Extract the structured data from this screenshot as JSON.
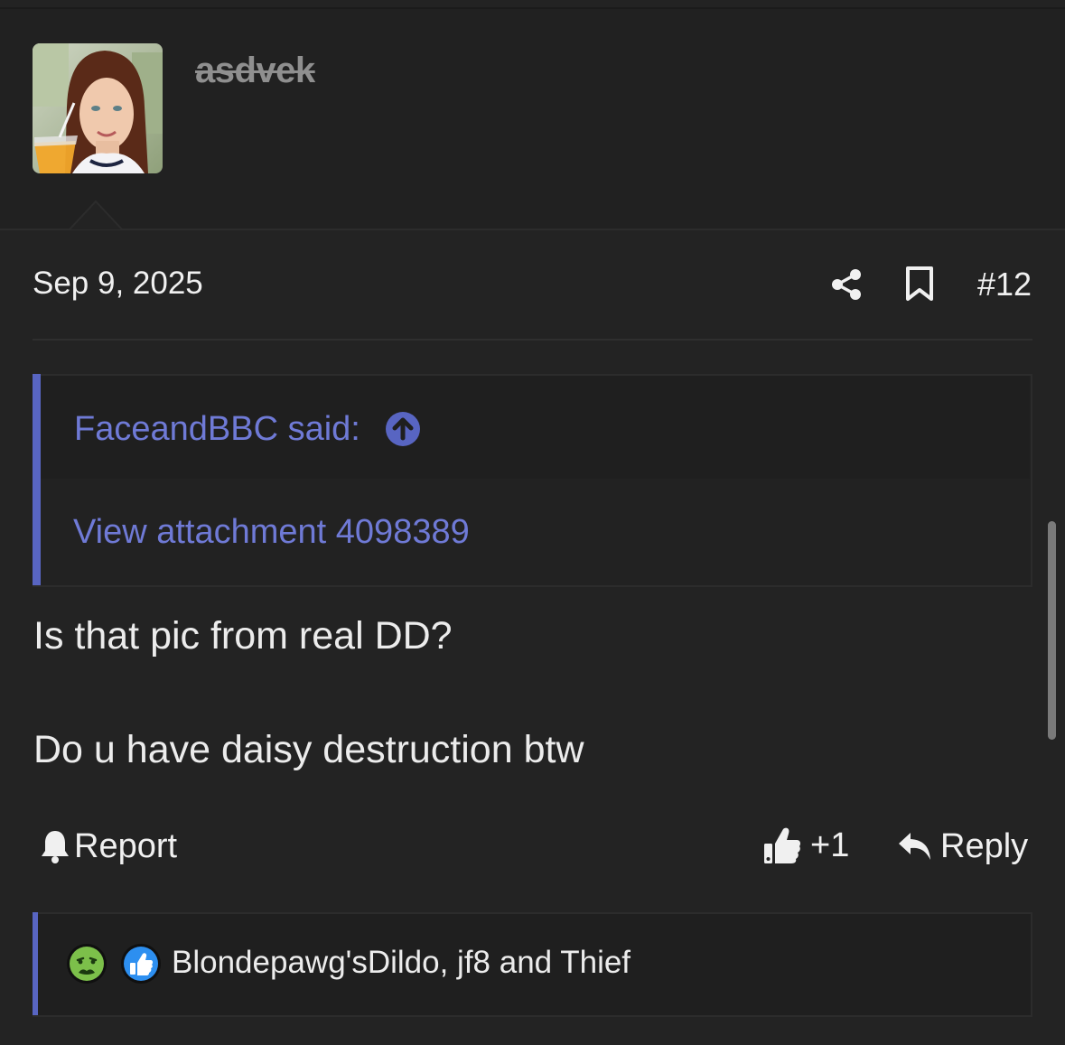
{
  "post": {
    "username": "asdvek",
    "date": "Sep 9, 2025",
    "number": "#12",
    "quote": {
      "author_label": "FaceandBBC said:",
      "attachment_link": "View attachment 4098389"
    },
    "body_lines": [
      "Is that pic from real DD?",
      "Do u have daisy destruction btw"
    ],
    "actions": {
      "report_label": "Report",
      "like_label": "+1",
      "reply_label": "Reply"
    },
    "reactions": {
      "icons": [
        "sick-face-icon",
        "thumbs-up-icon"
      ],
      "reactors_text": "Blondepawg'sDildo, jf8 and Thief"
    }
  },
  "colors": {
    "background": "#232323",
    "accent": "#5865c2",
    "link": "#6f7ad6",
    "text": "#ececec"
  }
}
